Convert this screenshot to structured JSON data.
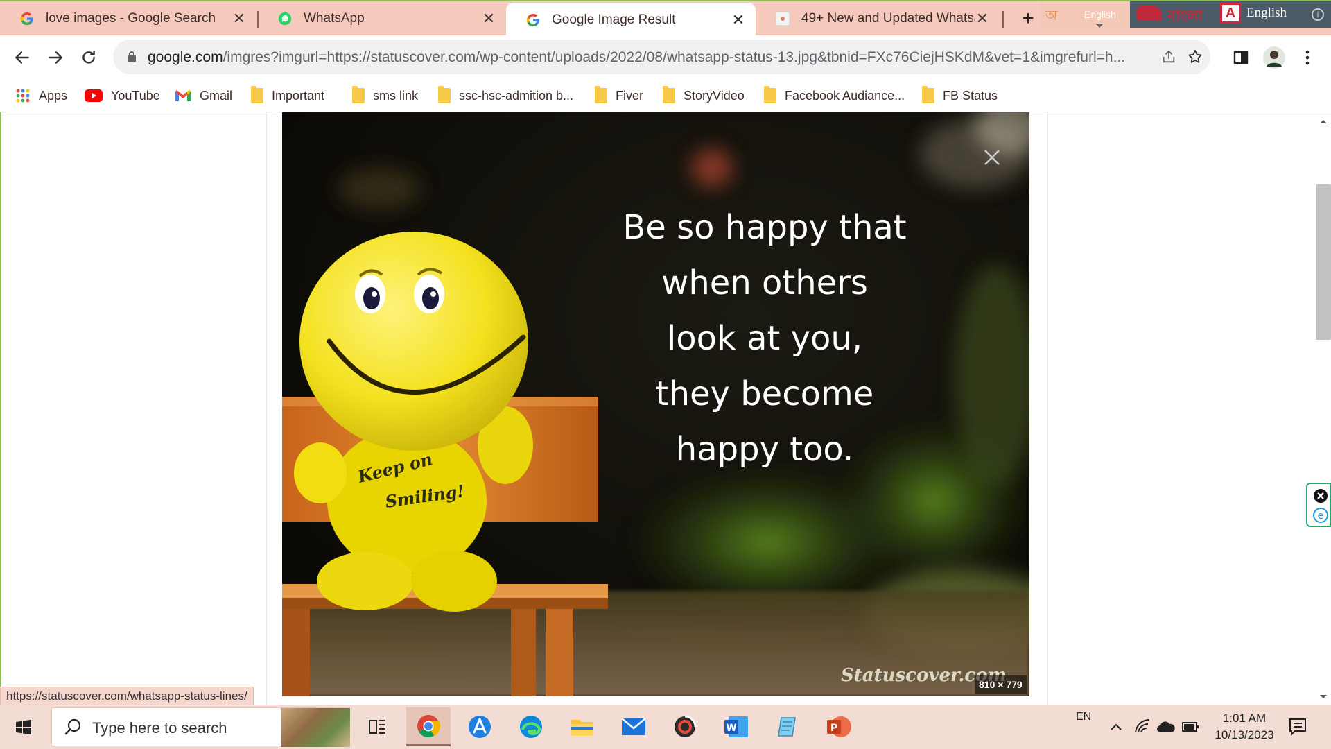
{
  "tabs": [
    {
      "title": "love images - Google Search",
      "favicon": "google-icon",
      "active": false
    },
    {
      "title": "WhatsApp",
      "favicon": "whatsapp-icon",
      "active": false
    },
    {
      "title": "Google Image Result",
      "favicon": "google-icon",
      "active": true
    },
    {
      "title": "49+ New and Updated Whatsapp Status",
      "favicon": "site-icon",
      "active": false
    }
  ],
  "ime": {
    "bangla_glyph": "অ",
    "language_small": "English",
    "bangla_brand": "বাংলা",
    "language": "English"
  },
  "address": {
    "host": "google.com",
    "path": "/imgres?imgurl=https://statuscover.com/wp-content/uploads/2022/08/whatsapp-status-13.jpg&tbnid=FXc76CiejHSKdM&vet=1&imgrefurl=h..."
  },
  "bookmarks": [
    {
      "label": "Apps",
      "icon": "apps-grid-icon"
    },
    {
      "label": "YouTube",
      "icon": "youtube-icon"
    },
    {
      "label": "Gmail",
      "icon": "gmail-icon"
    },
    {
      "label": "Important",
      "icon": "folder-icon"
    },
    {
      "label": "sms link",
      "icon": "folder-icon"
    },
    {
      "label": "ssc-hsc-admition b...",
      "icon": "folder-icon"
    },
    {
      "label": "Fiver",
      "icon": "folder-icon"
    },
    {
      "label": "StoryVideo",
      "icon": "folder-icon"
    },
    {
      "label": "Facebook Audiance...",
      "icon": "folder-icon"
    },
    {
      "label": "FB Status",
      "icon": "folder-icon"
    }
  ],
  "image": {
    "quote_lines": [
      "Be so happy that",
      "when others",
      "look at you,",
      "they become",
      "happy too."
    ],
    "toy_text_1": "Keep on",
    "toy_text_2": "Smiling!",
    "watermark": "Statuscover.com",
    "dimensions": "810 × 779"
  },
  "status_url": "https://statuscover.com/whatsapp-status-lines/",
  "taskbar": {
    "search_placeholder": "Type here to search",
    "apps": [
      "task-view-icon",
      "chrome-icon",
      "app-store-icon",
      "edge-icon",
      "file-explorer-icon",
      "mail-icon",
      "media-icon",
      "word-icon",
      "notepad-icon",
      "powerpoint-icon"
    ],
    "lang": "EN",
    "time": "1:01 AM",
    "date": "10/13/2023"
  }
}
